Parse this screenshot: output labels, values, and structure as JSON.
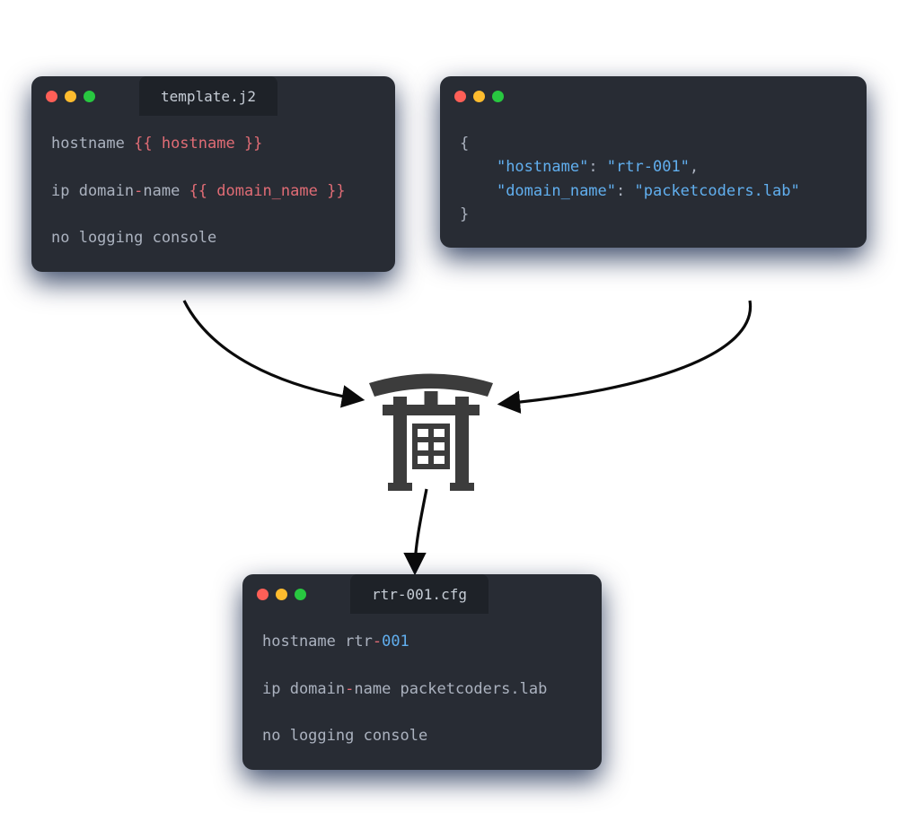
{
  "windows": {
    "template": {
      "title": "template.j2",
      "lines": {
        "l1_a": "hostname ",
        "l1_b": "{{ hostname }}",
        "l2_a": "ip domain",
        "l2_dash": "-",
        "l2_b": "name ",
        "l2_c": "{{ domain_name }}",
        "l3": "no logging console"
      }
    },
    "data": {
      "title": "",
      "json": {
        "open": "{",
        "k1": "\"hostname\"",
        "colon": ": ",
        "v1": "\"rtr-001\"",
        "comma": ",",
        "k2": "\"domain_name\"",
        "v2": "\"packetcoders.lab\"",
        "close": "}"
      }
    },
    "output": {
      "title": "rtr-001.cfg",
      "lines": {
        "l1_a": "hostname rtr",
        "l1_dash": "-",
        "l1_b": "001",
        "l2_a": "ip domain",
        "l2_dash": "-",
        "l2_b": "name packetcoders.lab",
        "l3": "no logging console"
      }
    }
  }
}
